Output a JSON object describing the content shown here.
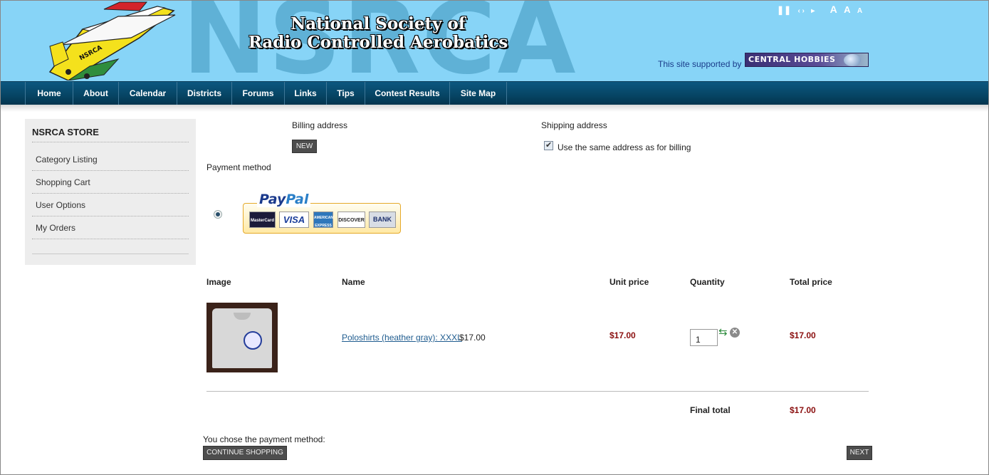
{
  "header": {
    "background_text": "NSRCA",
    "title_line1": "National Society of",
    "title_line2": "Radio Controlled Aerobatics",
    "plane_label": "NSRCA",
    "sponsor_text": "This site supported by",
    "sponsor_name": "CENTRAL HOBBIES",
    "tools": {
      "pause": "❚❚",
      "prev_next": "‹ ›",
      "next": "▸",
      "font_up": "A",
      "font_reset": "A",
      "font_down": "A"
    }
  },
  "nav": {
    "items": [
      "Home",
      "About",
      "Calendar",
      "Districts",
      "Forums",
      "Links",
      "Tips",
      "Contest Results",
      "Site Map"
    ]
  },
  "sidebar": {
    "title": "NSRCA STORE",
    "items": [
      "Category Listing",
      "Shopping Cart",
      "User Options",
      "My Orders"
    ]
  },
  "checkout": {
    "billing_label": "Billing address",
    "new_button": "NEW",
    "shipping_label": "Shipping address",
    "same_address_label": "Use the same address as for billing",
    "same_address_checked": true,
    "payment_method_label": "Payment method",
    "paypal": {
      "word1": "Pay",
      "word2": "Pal",
      "cards": [
        "MasterCard",
        "VISA",
        "AMERICAN EXPRESS",
        "DISCOVER",
        "BANK"
      ]
    },
    "payment_selected": true,
    "columns": [
      "Image",
      "Name",
      "Unit price",
      "Quantity",
      "Total price"
    ],
    "item": {
      "name": "Poloshirts (heather gray): XXXL",
      "price_inline": "$17.00",
      "unit_price": "$17.00",
      "quantity": "1",
      "total_price": "$17.00"
    },
    "final_total_label": "Final total",
    "final_total": "$17.00",
    "chosen_method_text": "You chose the payment method:",
    "continue_button": "CONTINUE SHOPPING",
    "next_button": "NEXT"
  },
  "colors": {
    "header_bg": "#87d4f7",
    "nav_bg": "#064463",
    "price_red": "#8b1010",
    "link": "#1f5c8f"
  }
}
